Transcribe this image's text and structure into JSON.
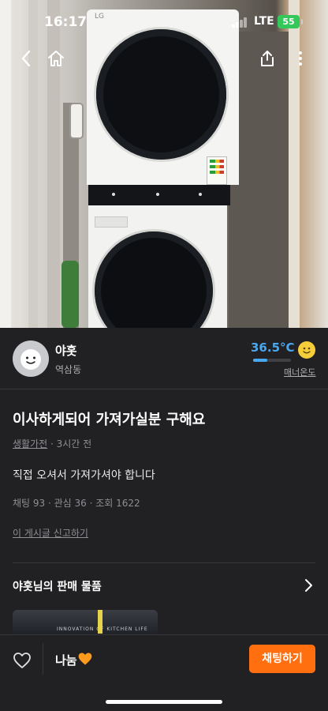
{
  "status_bar": {
    "time": "16:17",
    "network": "LTE",
    "battery": "55"
  },
  "hero": {
    "image_alt": "LG washer and dryer tower",
    "brand_mark": "LG"
  },
  "nav": {
    "back_icon": "chevron-left-icon",
    "home_icon": "home-icon",
    "share_icon": "share-icon",
    "more_icon": "more-vertical-icon"
  },
  "seller": {
    "name": "야홋",
    "location": "역삼동",
    "temperature": "36.5°C",
    "temperature_level": 0.365,
    "manner_label": "매너온도"
  },
  "post": {
    "title": "이사하게되어 가져가실분 구해요",
    "category": "생활가전",
    "time_ago": "3시간 전",
    "body": "직접 오셔서 가져가셔야 합니다",
    "stats": "채팅 93 · 관심 36 · 조회 1622",
    "report_link": "이 게시글 신고하기"
  },
  "more_items": {
    "title": "야홋님의 판매 물품",
    "thumb_caption": "INNOVATION OF KITCHEN LIFE"
  },
  "bottom_bar": {
    "price_label": "나눔",
    "chat_button": "채팅하기"
  },
  "colors": {
    "accent": "#ff6f0f",
    "temperature": "#4aa8f0",
    "background": "#212123"
  }
}
